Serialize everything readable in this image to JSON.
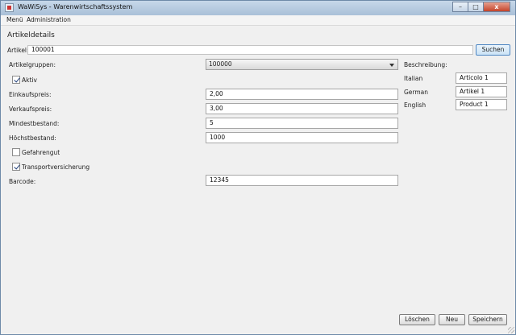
{
  "window": {
    "title": "WaWiSys - Warenwirtschaftssystem",
    "buttons": {
      "minimize": "–",
      "maximize": "□",
      "close": "x"
    }
  },
  "menubar": {
    "items": [
      "Menü",
      "Administration"
    ]
  },
  "page": {
    "title": "Artikeldetails"
  },
  "search": {
    "label": "Artikel:",
    "value": "100001",
    "button": "Suchen"
  },
  "form": {
    "artikelgruppen": {
      "label": "Artikelgruppen:",
      "value": "100000"
    },
    "aktiv": {
      "label": "Aktiv",
      "checked": true
    },
    "einkaufspreis": {
      "label": "Einkaufspreis:",
      "value": "2,00"
    },
    "verkaufspreis": {
      "label": "Verkaufspreis:",
      "value": "3,00"
    },
    "mindestbestand": {
      "label": "Mindestbestand:",
      "value": "5"
    },
    "hoechstbestand": {
      "label": "Höchstbestand:",
      "value": "1000"
    },
    "gefahrengut": {
      "label": "Gefahrengut",
      "checked": false
    },
    "transportversicherung": {
      "label": "Transportversicherung",
      "checked": true
    },
    "barcode": {
      "label": "Barcode:",
      "value": "12345"
    }
  },
  "beschreibung": {
    "label": "Beschreibung:",
    "rows": [
      {
        "language": "Italian",
        "value": "Articolo 1"
      },
      {
        "language": "German",
        "value": "Artikel 1"
      },
      {
        "language": "English",
        "value": "Product 1"
      }
    ]
  },
  "actions": {
    "delete": "Löschen",
    "new": "Neu",
    "save": "Speichern"
  }
}
